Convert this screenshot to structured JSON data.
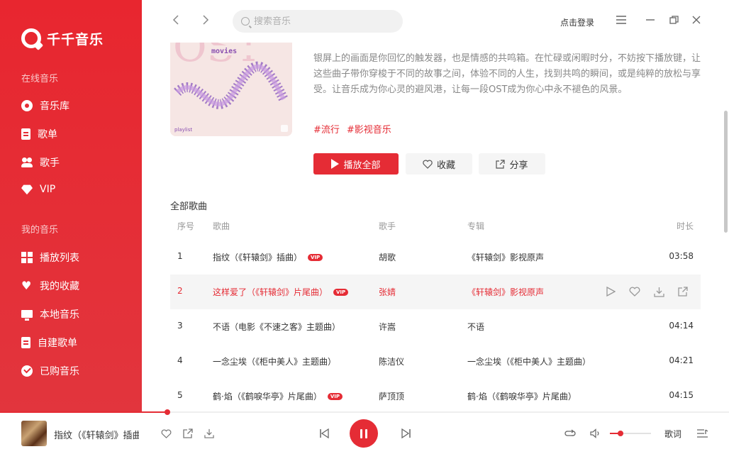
{
  "app": {
    "name": "千千音乐"
  },
  "sidebar": {
    "online_title": "在线音乐",
    "online_items": [
      {
        "label": "音乐库",
        "icon": "disc-icon"
      },
      {
        "label": "歌单",
        "icon": "playlist-icon"
      },
      {
        "label": "歌手",
        "icon": "artist-icon"
      },
      {
        "label": "VIP",
        "icon": "vip-diamond-icon"
      }
    ],
    "mine_title": "我的音乐",
    "mine_items": [
      {
        "label": "播放列表",
        "icon": "grid-icon"
      },
      {
        "label": "我的收藏",
        "icon": "heart-icon"
      },
      {
        "label": "本地音乐",
        "icon": "monitor-icon"
      },
      {
        "label": "自建歌单",
        "icon": "doc-icon"
      },
      {
        "label": "已购音乐",
        "icon": "check-circle-icon"
      }
    ]
  },
  "topbar": {
    "search_placeholder": "搜索音乐",
    "login_label": "点击登录"
  },
  "playlist": {
    "cover_word": "movies",
    "cover_bg_text": "OST",
    "cover_tag": "playlist",
    "description": "银屏上的画面是你回忆的触发器，也是情感的共鸣箱。在忙碌或闲暇时分，不妨按下播放键，让这些曲子带你穿梭于不同的故事之间，体验不同的人生，找到共鸣的瞬间，或是纯粹的放松与享受。让音乐成为你心灵的避风港，让每一段OST成为你心中永不褪色的风景。",
    "tags": [
      "#流行",
      "#影视音乐"
    ],
    "play_all": "播放全部",
    "collect": "收藏",
    "share": "分享"
  },
  "songs": {
    "section_title": "全部歌曲",
    "headers": {
      "index": "序号",
      "title": "歌曲",
      "artist": "歌手",
      "album": "专辑",
      "duration": "时长"
    },
    "vip_badge": "VIP",
    "rows": [
      {
        "index": "1",
        "title": "指纹（《轩辕剑》插曲）",
        "vip": true,
        "artist": "胡歌",
        "album": "《轩辕剑》影视原声",
        "duration": "03:58"
      },
      {
        "index": "2",
        "title": "这样爱了（《轩辕剑》片尾曲）",
        "vip": true,
        "artist": "张婧",
        "album": "《轩辕剑》影视原声",
        "duration": ""
      },
      {
        "index": "3",
        "title": "不语（电影《不速之客》主题曲）",
        "vip": false,
        "artist": "许嵩",
        "album": "不语",
        "duration": "04:14"
      },
      {
        "index": "4",
        "title": "一念尘埃（《柜中美人》主题曲）",
        "vip": false,
        "artist": "陈洁仪",
        "album": "一念尘埃（《柜中美人》主题曲）",
        "duration": "04:21"
      },
      {
        "index": "5",
        "title": "鹤·焰（《鹤唳华亭》片尾曲）",
        "vip": true,
        "artist": "萨顶顶",
        "album": "鹤·焰（《鹤唳华亭》片尾曲）",
        "duration": "04:15"
      }
    ],
    "active_index": 1
  },
  "player": {
    "now_playing": "指纹（《轩辕剑》插曲）",
    "progress_fraction": 0.23,
    "volume_fraction": 0.25,
    "lyrics_label": "歌词"
  },
  "colors": {
    "accent": "#e52c35"
  }
}
